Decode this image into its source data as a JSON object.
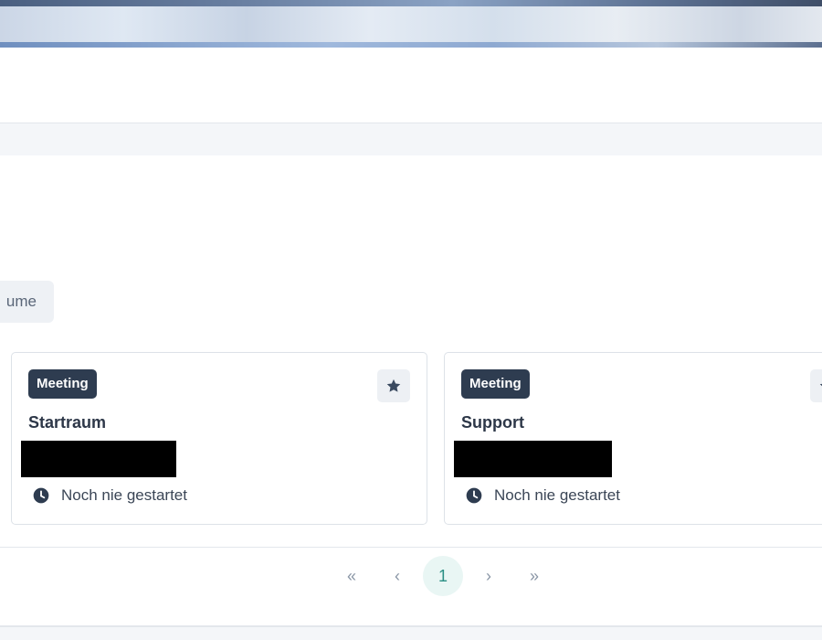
{
  "filter": {
    "partial_label": "ume"
  },
  "rooms": [
    {
      "badge": "Meeting",
      "name": "Startraum",
      "status": "Noch nie gestartet",
      "favorite_icon": "star-icon",
      "status_icon": "clock-icon"
    },
    {
      "badge": "Meeting",
      "name": "Support",
      "status": "Noch nie gestartet",
      "favorite_icon": "star-icon",
      "status_icon": "clock-icon"
    }
  ],
  "pagination": {
    "first": "«",
    "prev": "‹",
    "current": "1",
    "next": "›",
    "last": "»"
  },
  "colors": {
    "badge_bg": "#2e3c50",
    "active_page_bg": "#e9f6f4",
    "active_page_text": "#2a8f84"
  }
}
